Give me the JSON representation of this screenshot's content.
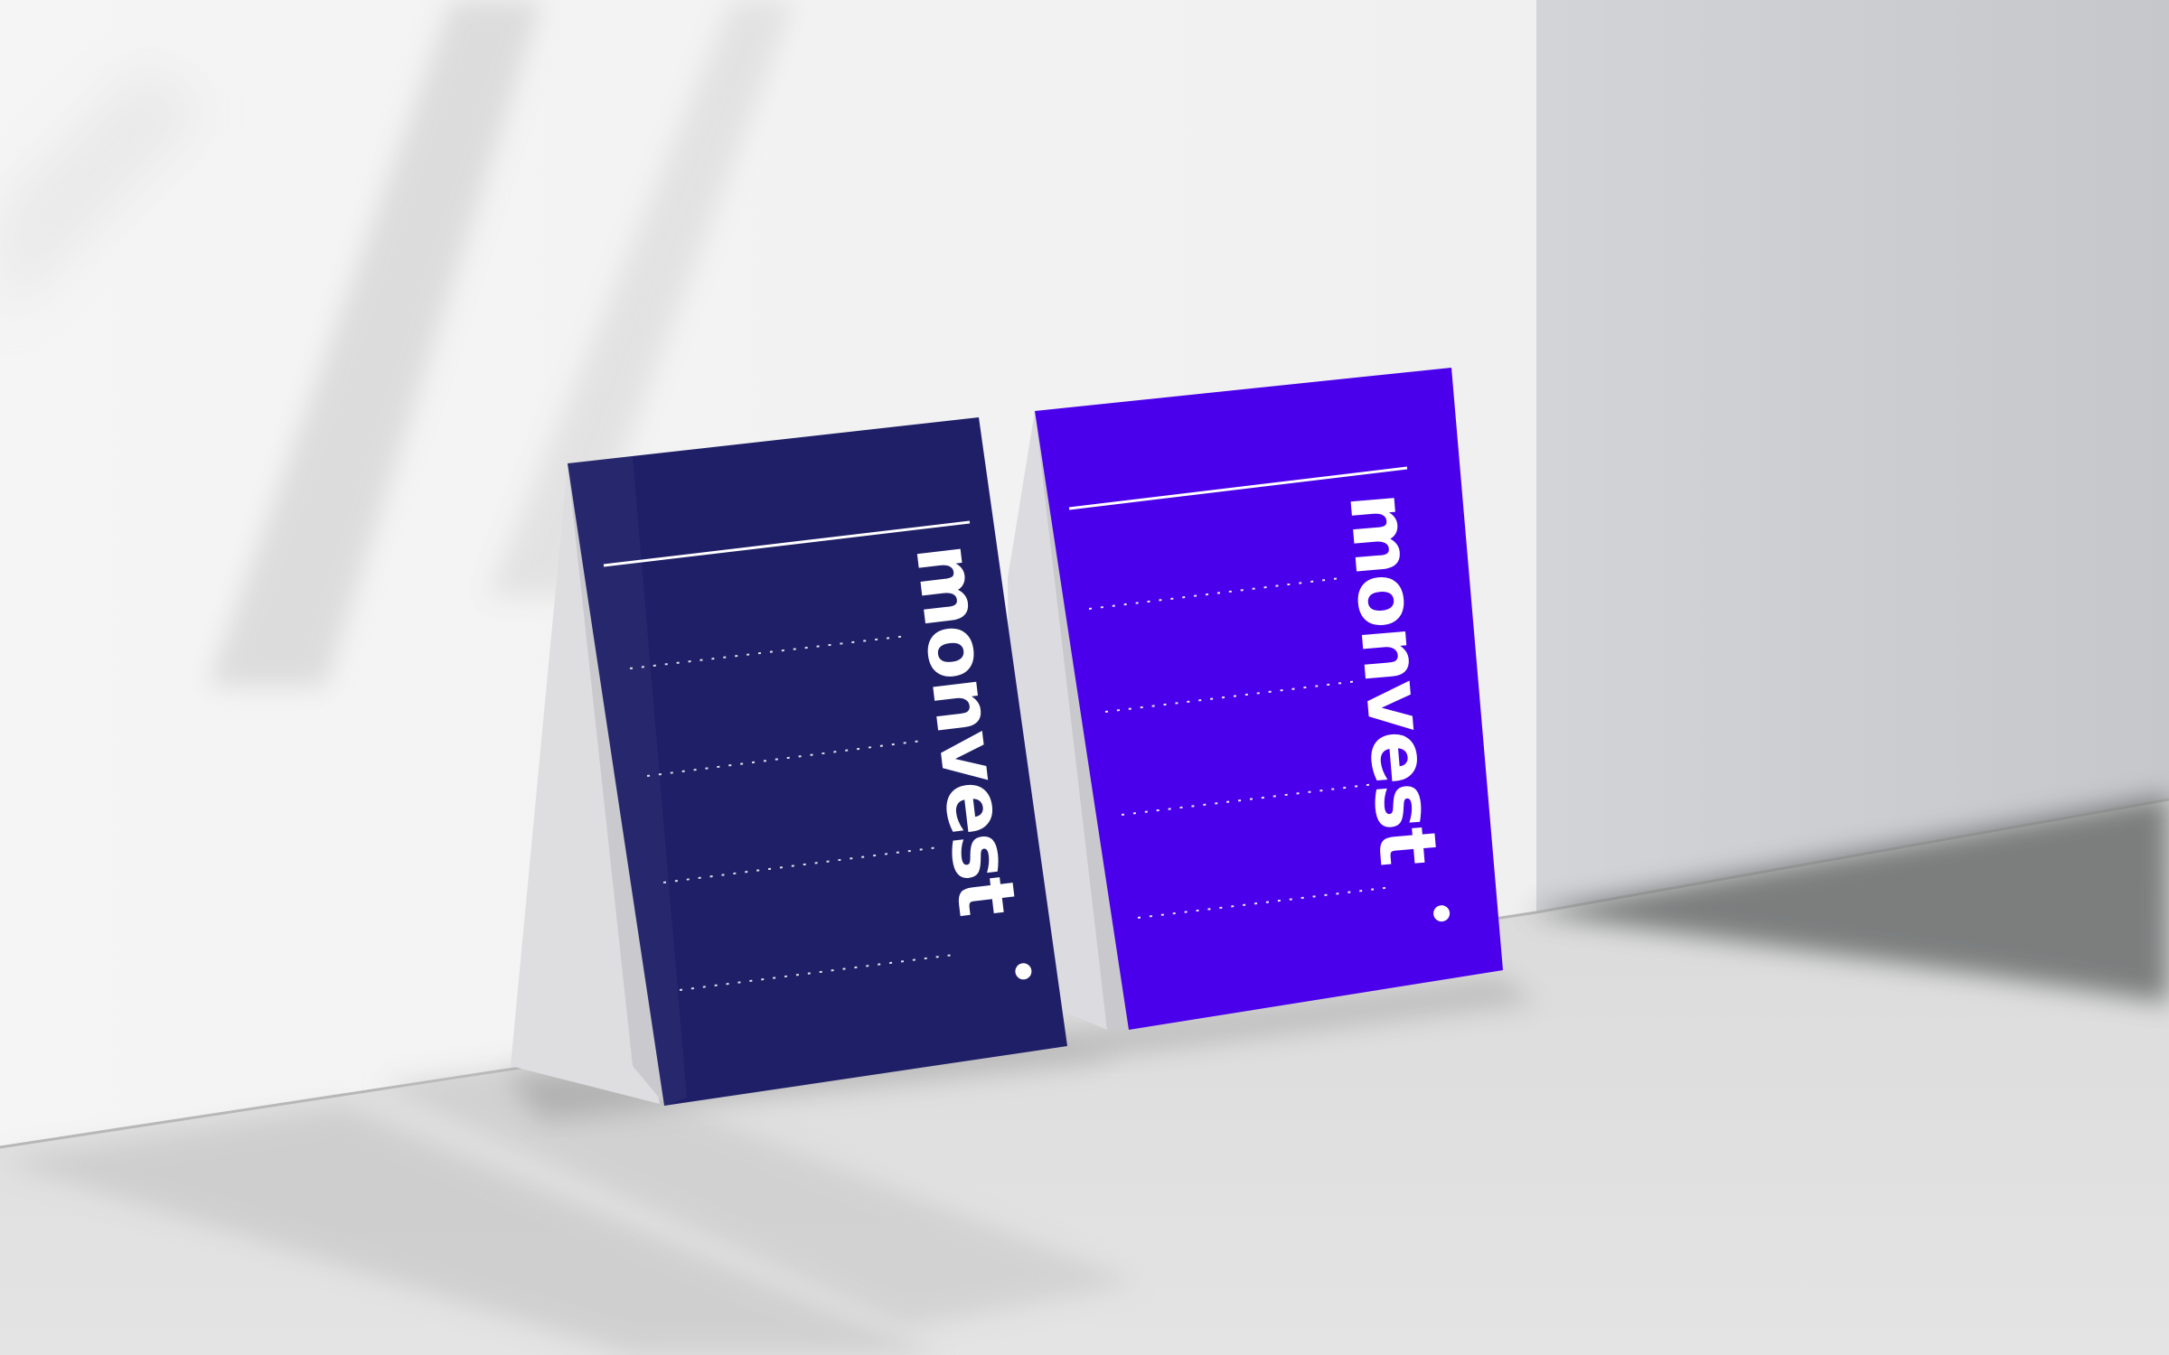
{
  "scene": {
    "description_label": "",
    "colors": {
      "wall": "#f2f2f2",
      "wall_shadow": "#cdcfd2",
      "floor": "#dcdcdc",
      "floor_shadow": "#6d6f6f",
      "card_navy": "#1f1f68",
      "card_violet": "#4a00ea",
      "card_edge": "#d5d5d8",
      "print_white": "#ffffff"
    }
  },
  "cards": [
    {
      "id": "navy",
      "wordmark": "monvest",
      "color": "#1f1f68",
      "dotted_lines": 4
    },
    {
      "id": "violet",
      "wordmark": "monvest",
      "color": "#4a00ea",
      "dotted_lines": 4
    }
  ]
}
